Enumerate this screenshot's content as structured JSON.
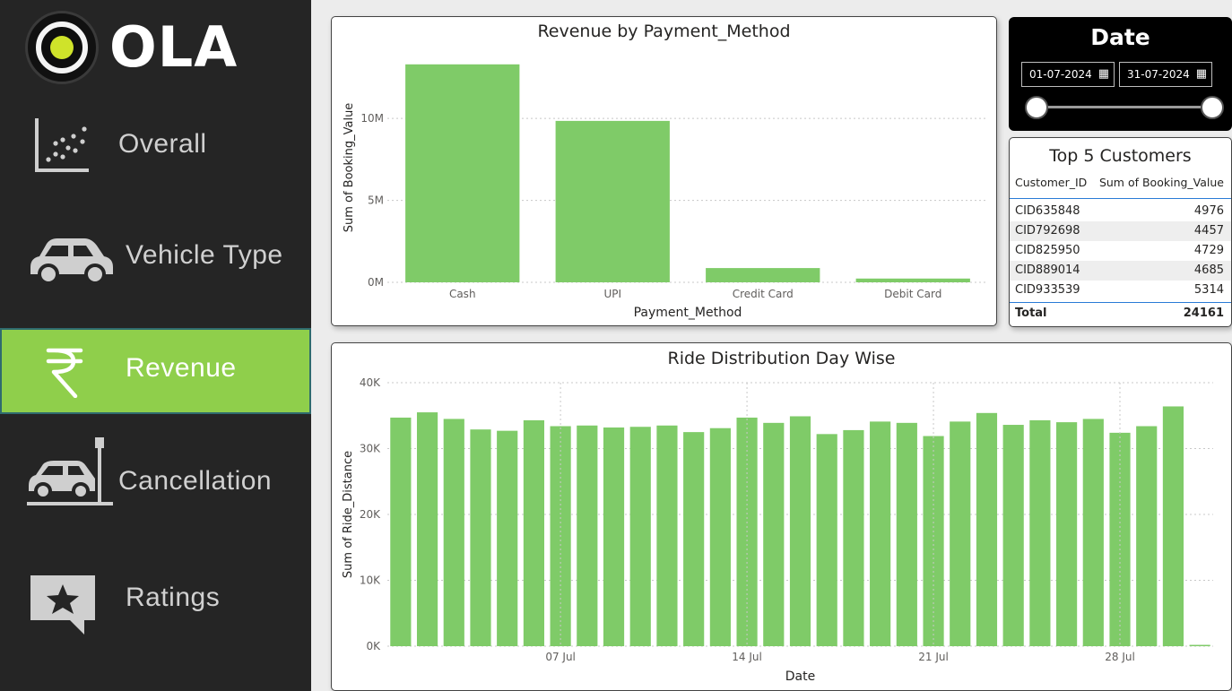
{
  "brand": {
    "name": "OLA"
  },
  "colors": {
    "accent": "#8fcf4b",
    "bar": "#7fcb68",
    "sidebar": "#252525"
  },
  "nav": [
    {
      "label": "Overall",
      "icon": "scatter-chart-icon",
      "active": false
    },
    {
      "label": "Vehicle Type",
      "icon": "car-icon",
      "active": false
    },
    {
      "label": "Revenue",
      "icon": "rupee-icon",
      "active": true
    },
    {
      "label": "Cancellation",
      "icon": "car-crash-icon",
      "active": false
    },
    {
      "label": "Ratings",
      "icon": "star-chat-icon",
      "active": false
    }
  ],
  "date_filter": {
    "title": "Date",
    "start": "01-07-2024",
    "end": "31-07-2024"
  },
  "top_customers": {
    "title": "Top 5 Customers",
    "columns": [
      "Customer_ID",
      "Sum of Booking_Value"
    ],
    "rows": [
      {
        "id": "CID635848",
        "value": "4976"
      },
      {
        "id": "CID792698",
        "value": "4457"
      },
      {
        "id": "CID825950",
        "value": "4729"
      },
      {
        "id": "CID889014",
        "value": "4685"
      },
      {
        "id": "CID933539",
        "value": "5314"
      }
    ],
    "total_label": "Total",
    "total_value": "24161"
  },
  "chart_data": [
    {
      "type": "bar",
      "title": "Revenue by Payment_Method",
      "xlabel": "Payment_Method",
      "ylabel": "Sum of Booking_Value",
      "categories": [
        "Cash",
        "UPI",
        "Credit Card",
        "Debit Card"
      ],
      "values": [
        13300000,
        9850000,
        870000,
        230000
      ],
      "ylim": [
        0,
        14000000
      ],
      "yticks": [
        0,
        5000000,
        10000000
      ],
      "ytick_labels": [
        "0M",
        "5M",
        "10M"
      ],
      "grid": true
    },
    {
      "type": "bar",
      "title": "Ride Distribution Day Wise",
      "xlabel": "Date",
      "ylabel": "Sum of Ride_Distance",
      "x": [
        "2024-07-01",
        "2024-07-02",
        "2024-07-03",
        "2024-07-04",
        "2024-07-05",
        "2024-07-06",
        "2024-07-07",
        "2024-07-08",
        "2024-07-09",
        "2024-07-10",
        "2024-07-11",
        "2024-07-12",
        "2024-07-13",
        "2024-07-14",
        "2024-07-15",
        "2024-07-16",
        "2024-07-17",
        "2024-07-18",
        "2024-07-19",
        "2024-07-20",
        "2024-07-21",
        "2024-07-22",
        "2024-07-23",
        "2024-07-24",
        "2024-07-25",
        "2024-07-26",
        "2024-07-27",
        "2024-07-28",
        "2024-07-29",
        "2024-07-30",
        "2024-07-31"
      ],
      "values": [
        34700,
        35500,
        34500,
        32900,
        32700,
        34300,
        33400,
        33500,
        33200,
        33300,
        33500,
        32500,
        33100,
        34700,
        33900,
        34900,
        32200,
        32800,
        34100,
        33900,
        31900,
        34100,
        35400,
        33600,
        34300,
        34000,
        34500,
        32400,
        33400,
        36400,
        200
      ],
      "ylim": [
        0,
        40000
      ],
      "yticks": [
        0,
        10000,
        20000,
        30000,
        40000
      ],
      "ytick_labels": [
        "0K",
        "10K",
        "20K",
        "30K",
        "40K"
      ],
      "xtick_labels": [
        "07 Jul",
        "14 Jul",
        "21 Jul",
        "28 Jul"
      ],
      "xtick_dates": [
        "2024-07-07",
        "2024-07-14",
        "2024-07-21",
        "2024-07-28"
      ],
      "grid": true
    }
  ]
}
